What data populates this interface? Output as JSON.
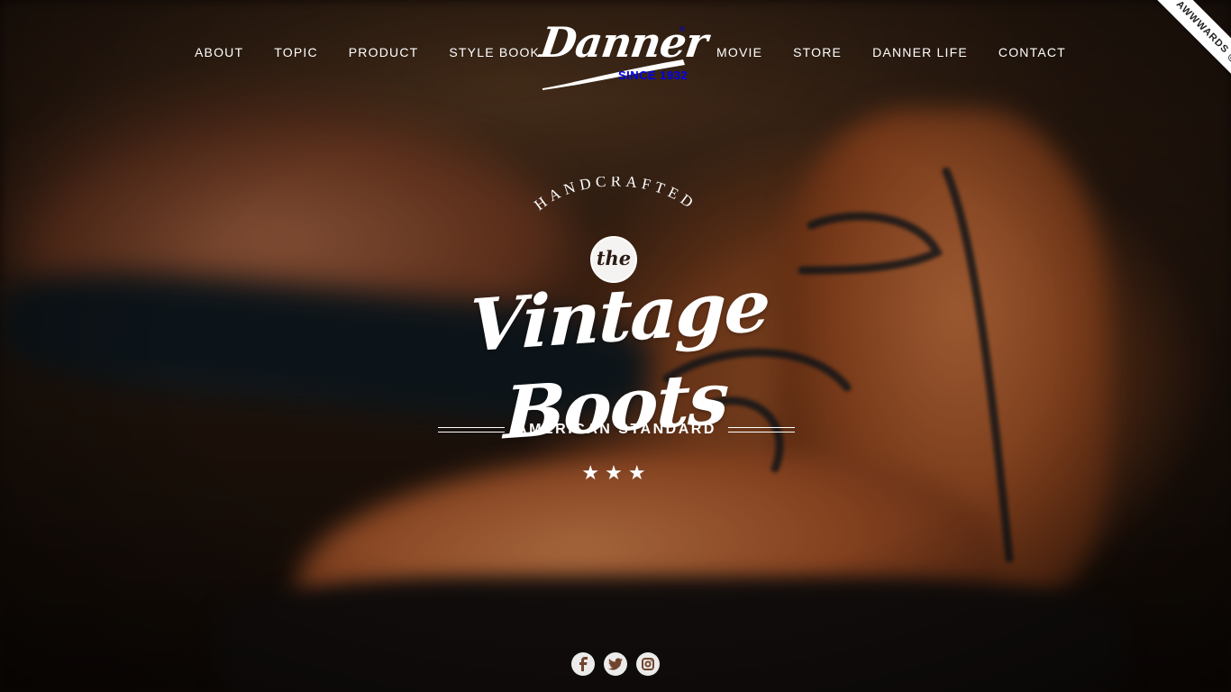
{
  "nav": {
    "left": [
      "ABOUT",
      "TOPIC",
      "PRODUCT",
      "STYLE BOOK"
    ],
    "right": [
      "MOVIE",
      "STORE",
      "DANNER LIFE",
      "CONTACT"
    ]
  },
  "logo": {
    "script": "Danner",
    "since": "SINCE 1932",
    "registered": "®"
  },
  "ribbon": {
    "text": "AWWWARDS @H.M"
  },
  "hero": {
    "arc_text": "HANDCRAFTED",
    "badge": "the",
    "headline": "Vintage Boots",
    "subtitle": "AMERICAN STANDARD",
    "stars": "★★★"
  },
  "social": {
    "icons": [
      "facebook-icon",
      "twitter-icon",
      "instagram-icon"
    ]
  },
  "colors": {
    "text": "#ffffff",
    "leather": "#b3582a",
    "dark": "#120a06"
  }
}
